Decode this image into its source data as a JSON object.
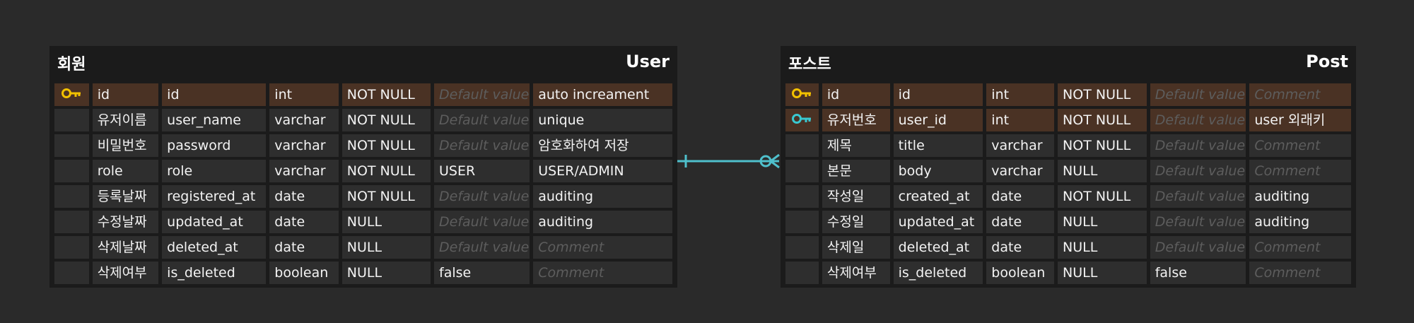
{
  "colors": {
    "canvas": "#2a2a2a",
    "table_bg": "#1b1b1b",
    "cell_bg": "#2e2e2e",
    "key_row_bg": "#4a3224",
    "primary_key": "#f2c100",
    "foreign_key": "#39c8d0",
    "relation_line": "#4fc0cc",
    "placeholder_text": "#5d5d5d"
  },
  "relationship": {
    "from": "user.id",
    "to": "post.user_id",
    "from_cardinality": "one",
    "to_cardinality": "zero-or-many"
  },
  "tables": {
    "user": {
      "logical_name": "회원",
      "physical_name": "User",
      "rows": [
        {
          "key": "primary-key",
          "logical": "id",
          "physical": "id",
          "type": "int",
          "nullable": "NOT NULL",
          "default": "Default value",
          "default_is_placeholder": true,
          "comment": "auto increament",
          "comment_is_placeholder": false
        },
        {
          "key": "",
          "logical": "유저이름",
          "physical": "user_name",
          "type": "varchar",
          "nullable": "NOT NULL",
          "default": "Default value",
          "default_is_placeholder": true,
          "comment": "unique",
          "comment_is_placeholder": false
        },
        {
          "key": "",
          "logical": "비밀번호",
          "physical": "password",
          "type": "varchar",
          "nullable": "NOT NULL",
          "default": "Default value",
          "default_is_placeholder": true,
          "comment": "암호화하여 저장",
          "comment_is_placeholder": false
        },
        {
          "key": "",
          "logical": "role",
          "physical": "role",
          "type": "varchar",
          "nullable": "NOT NULL",
          "default": "USER",
          "default_is_placeholder": false,
          "comment": "USER/ADMIN",
          "comment_is_placeholder": false
        },
        {
          "key": "",
          "logical": "등록날짜",
          "physical": "registered_at",
          "type": "date",
          "nullable": "NOT NULL",
          "default": "Default value",
          "default_is_placeholder": true,
          "comment": "auditing",
          "comment_is_placeholder": false
        },
        {
          "key": "",
          "logical": "수정날짜",
          "physical": "updated_at",
          "type": "date",
          "nullable": "NULL",
          "default": "Default value",
          "default_is_placeholder": true,
          "comment": "auditing",
          "comment_is_placeholder": false
        },
        {
          "key": "",
          "logical": "삭제날짜",
          "physical": "deleted_at",
          "type": "date",
          "nullable": "NULL",
          "default": "Default value",
          "default_is_placeholder": true,
          "comment": "Comment",
          "comment_is_placeholder": true
        },
        {
          "key": "",
          "logical": "삭제여부",
          "physical": "is_deleted",
          "type": "boolean",
          "nullable": "NULL",
          "default": "false",
          "default_is_placeholder": false,
          "comment": "Comment",
          "comment_is_placeholder": true
        }
      ]
    },
    "post": {
      "logical_name": "포스트",
      "physical_name": "Post",
      "rows": [
        {
          "key": "primary-key",
          "logical": "id",
          "physical": "id",
          "type": "int",
          "nullable": "NOT NULL",
          "default": "Default value",
          "default_is_placeholder": true,
          "comment": "Comment",
          "comment_is_placeholder": true
        },
        {
          "key": "foreign-key",
          "logical": "유저번호",
          "physical": "user_id",
          "type": "int",
          "nullable": "NOT NULL",
          "default": "Default value",
          "default_is_placeholder": true,
          "comment": "user 외래키",
          "comment_is_placeholder": false
        },
        {
          "key": "",
          "logical": "제목",
          "physical": "title",
          "type": "varchar",
          "nullable": "NOT NULL",
          "default": "Default value",
          "default_is_placeholder": true,
          "comment": "Comment",
          "comment_is_placeholder": true
        },
        {
          "key": "",
          "logical": "본문",
          "physical": "body",
          "type": "varchar",
          "nullable": "NULL",
          "default": "Default value",
          "default_is_placeholder": true,
          "comment": "Comment",
          "comment_is_placeholder": true
        },
        {
          "key": "",
          "logical": "작성일",
          "physical": "created_at",
          "type": "date",
          "nullable": "NOT NULL",
          "default": "Default value",
          "default_is_placeholder": true,
          "comment": "auditing",
          "comment_is_placeholder": false
        },
        {
          "key": "",
          "logical": "수정일",
          "physical": "updated_at",
          "type": "date",
          "nullable": "NULL",
          "default": "Default value",
          "default_is_placeholder": true,
          "comment": "auditing",
          "comment_is_placeholder": false
        },
        {
          "key": "",
          "logical": "삭제일",
          "physical": "deleted_at",
          "type": "date",
          "nullable": "NULL",
          "default": "Default value",
          "default_is_placeholder": true,
          "comment": "Comment",
          "comment_is_placeholder": true
        },
        {
          "key": "",
          "logical": "삭제여부",
          "physical": "is_deleted",
          "type": "boolean",
          "nullable": "NULL",
          "default": "false",
          "default_is_placeholder": false,
          "comment": "Comment",
          "comment_is_placeholder": true
        }
      ]
    }
  }
}
